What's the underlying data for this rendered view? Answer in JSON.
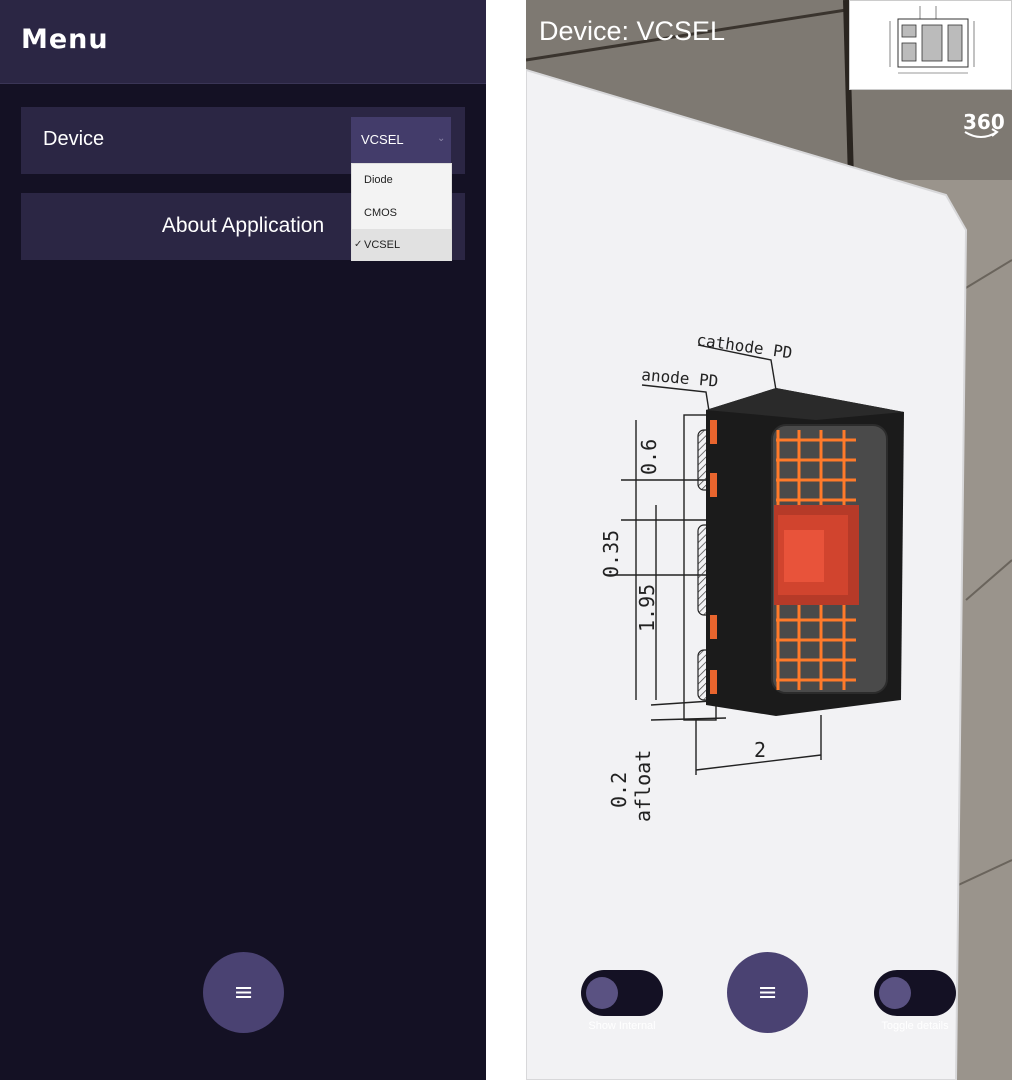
{
  "menu": {
    "title": "Menu",
    "device_label": "Device",
    "about_label": "About Application",
    "device_select": {
      "selected": "VCSEL",
      "options": [
        "Diode",
        "CMOS",
        "VCSEL"
      ]
    }
  },
  "viewer": {
    "device_title": "Device: VCSEL",
    "view_360_label": "360",
    "menu_button_icon": "≡",
    "toggles": [
      {
        "label": "Show Internal",
        "on": false
      },
      {
        "label": "Toggle details",
        "on": false
      }
    ]
  },
  "drawing_labels": {
    "cathode": "cathode PD",
    "anode": "anode PD",
    "dim_06": "0.6",
    "dim_035": "0.35",
    "dim_195": "1.95",
    "dim_2": "2",
    "dim_02": "0.2",
    "afloat": "afloat"
  },
  "icons": {
    "menu": "hamburger-icon",
    "view360": "view-360-icon",
    "chevron": "chevron-down-icon",
    "check": "checkmark-icon"
  },
  "colors": {
    "panel_bg": "#141124",
    "header_bg": "#2b2644",
    "accent": "#4a4272",
    "chip_orange": "#e8652e"
  }
}
